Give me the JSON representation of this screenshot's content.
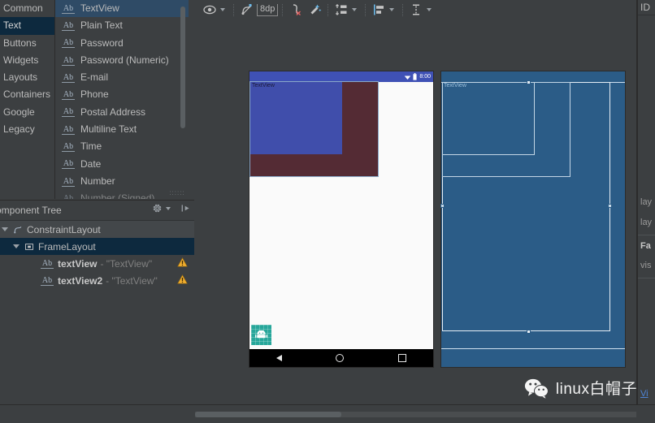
{
  "palette": {
    "categories": [
      {
        "label": "Common",
        "selected": false
      },
      {
        "label": "Text",
        "selected": true
      },
      {
        "label": "Buttons",
        "selected": false
      },
      {
        "label": "Widgets",
        "selected": false
      },
      {
        "label": "Layouts",
        "selected": false
      },
      {
        "label": "Containers",
        "selected": false
      },
      {
        "label": "Google",
        "selected": false
      },
      {
        "label": "Legacy",
        "selected": false
      }
    ],
    "icon_label": "Ab",
    "items": [
      {
        "label": "TextView",
        "selected": true
      },
      {
        "label": "Plain Text",
        "selected": false
      },
      {
        "label": "Password",
        "selected": false
      },
      {
        "label": "Password (Numeric)",
        "selected": false
      },
      {
        "label": "E-mail",
        "selected": false
      },
      {
        "label": "Phone",
        "selected": false
      },
      {
        "label": "Postal Address",
        "selected": false
      },
      {
        "label": "Multiline Text",
        "selected": false
      },
      {
        "label": "Time",
        "selected": false
      },
      {
        "label": "Date",
        "selected": false
      },
      {
        "label": "Number",
        "selected": false
      },
      {
        "label": "Number (Signed)",
        "selected": false
      }
    ],
    "grip": "::::::"
  },
  "component_tree": {
    "title": "omponent Tree",
    "rows": [
      {
        "label": "ConstraintLayout",
        "sub": "",
        "icon": "constraintlayout-icon",
        "depth": 0,
        "expanded": true,
        "highlight": "light",
        "warning": false
      },
      {
        "label": "FrameLayout",
        "sub": "",
        "icon": "framelayout-icon",
        "depth": 1,
        "expanded": true,
        "highlight": "blue",
        "warning": false
      },
      {
        "label": "textView",
        "sub": "- \"TextView\"",
        "icon": "textview-icon",
        "depth": 2,
        "expanded": false,
        "highlight": "none",
        "warning": true
      },
      {
        "label": "textView2",
        "sub": "- \"TextView\"",
        "icon": "textview-icon",
        "depth": 2,
        "expanded": false,
        "highlight": "none",
        "warning": true
      }
    ],
    "gear_icon": "gear-icon",
    "collapse_icon": "collapse-all-icon"
  },
  "design_toolbar": {
    "items": [
      {
        "name": "view-options-icon",
        "has_caret": true
      },
      {
        "name": "clear-constraints-icon",
        "has_caret": false
      },
      {
        "name": "default-margin-value",
        "value": "8dp",
        "has_caret": false
      },
      {
        "name": "infer-constraints-icon",
        "has_caret": false
      },
      {
        "name": "magic-autoconnect-icon",
        "has_caret": false
      },
      {
        "name": "pack-align-icon",
        "has_caret": true
      },
      {
        "name": "align-horizontal-icon",
        "has_caret": true
      },
      {
        "name": "guidelines-icon",
        "has_caret": true
      }
    ]
  },
  "device_render": {
    "status_time": "8:00",
    "wifi_icon": "wifi-icon",
    "battery_icon": "battery-icon",
    "textview_caption": "TextView",
    "app_icon": "android-robot-icon",
    "nav": {
      "back_icon": "nav-back-icon",
      "home_icon": "nav-home-icon",
      "recents_icon": "nav-recents-icon"
    },
    "colors": {
      "status_bar": "#3f51b5",
      "textview": "#3f51b5",
      "textview2": "#4b2029",
      "background": "#fafafa",
      "nav_bar": "#000000",
      "app_icon": "#26a69a"
    }
  },
  "device_blueprint": {
    "caption": "TextView",
    "colors": {
      "fill": "#2b5c87",
      "stroke": "#c3d6e6"
    }
  },
  "attributes": {
    "header": "ID",
    "rows": [
      {
        "label": "lay",
        "bold": false
      },
      {
        "label": "lay",
        "bold": false
      },
      {
        "label": "Fa",
        "bold": true
      },
      {
        "label": "vis",
        "bold": false
      }
    ],
    "link": "Vi"
  },
  "watermark": {
    "icon": "wechat-icon",
    "text": "linux白帽子"
  },
  "theme": {
    "bg": "#3c3f41",
    "panel_border": "#2b2b2b",
    "text": "#bbbbbb",
    "selection_blue": "#0d293e",
    "selection_item": "#2f4b66",
    "warning": "#f0ad2e",
    "link": "#4e84d6"
  }
}
